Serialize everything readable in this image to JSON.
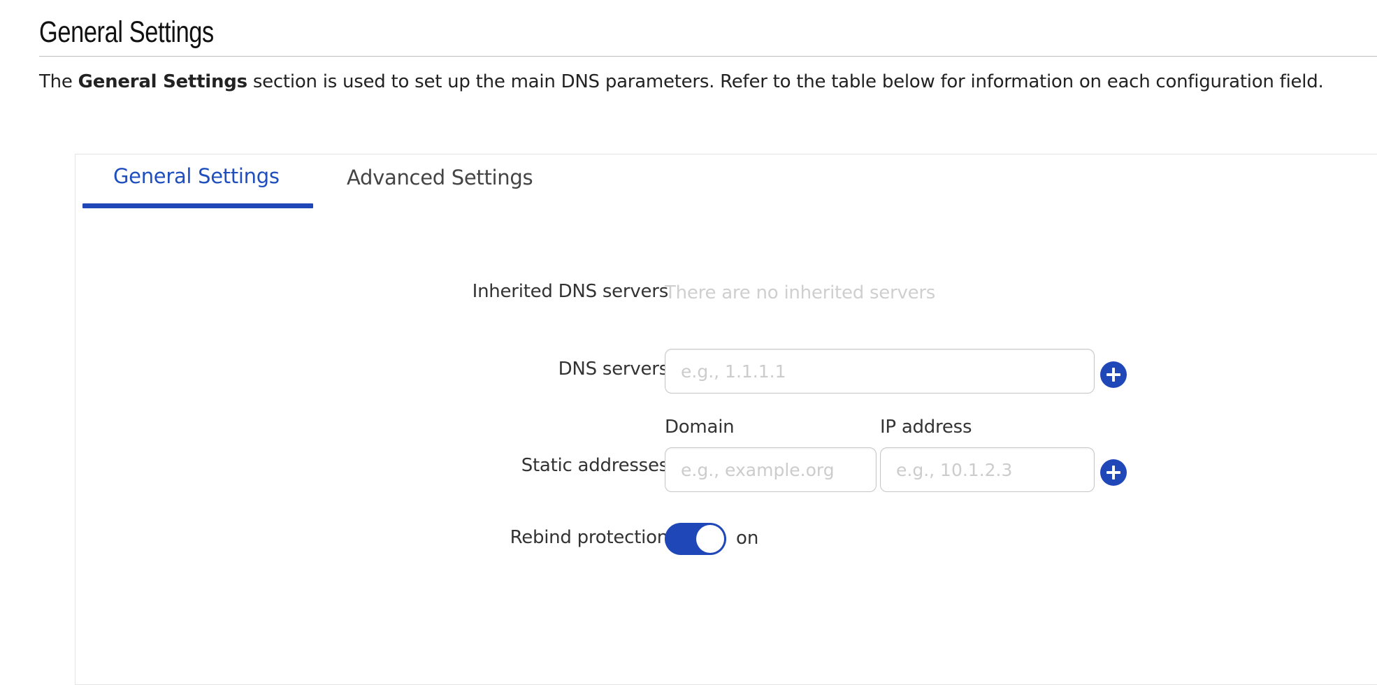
{
  "doc": {
    "title": "General Settings",
    "intro_prefix": "The ",
    "intro_bold": "General Settings",
    "intro_suffix": " section is used to set up the main DNS parameters. Refer to the table below for information on each configuration field."
  },
  "tabs": [
    {
      "label": "General Settings",
      "active": true
    },
    {
      "label": "Advanced Settings",
      "active": false
    }
  ],
  "form": {
    "inherited_dns": {
      "label": "Inherited DNS servers",
      "value": "There are no inherited servers"
    },
    "dns_servers": {
      "label": "DNS servers",
      "placeholder": "e.g., 1.1.1.1",
      "value": ""
    },
    "static_addresses": {
      "label": "Static addresses",
      "domain_header": "Domain",
      "ip_header": "IP address",
      "domain_placeholder": "e.g., example.org",
      "ip_placeholder": "e.g., 10.1.2.3",
      "domain_value": "",
      "ip_value": ""
    },
    "rebind_protection": {
      "label": "Rebind protection",
      "state": "on",
      "enabled": true
    }
  },
  "icons": {
    "add_dns": "plus-circle-icon",
    "add_static": "plus-circle-icon"
  },
  "colors": {
    "accent": "#1f47b8",
    "active_tab_text": "#1f4fbf"
  }
}
